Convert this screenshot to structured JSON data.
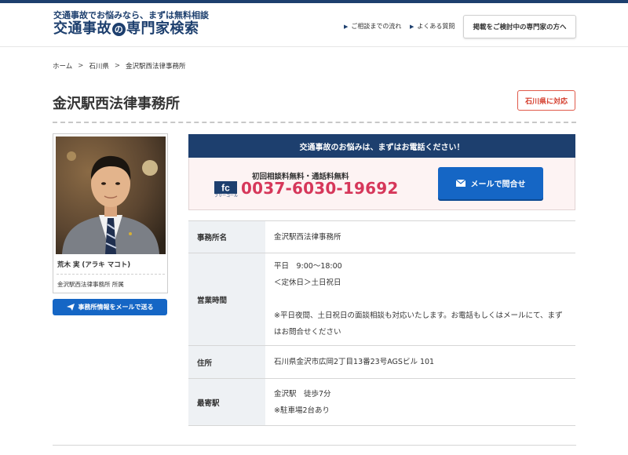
{
  "header": {
    "tagline": "交通事故でお悩みなら、まずは無料相談",
    "title_part1": "交通事故",
    "title_circle": "の",
    "title_part2": "専門家検索",
    "nav": [
      {
        "label": "ご相談までの流れ"
      },
      {
        "label": "よくある質問"
      }
    ],
    "expert_button": "掲載をご検討中の専門家の方へ"
  },
  "breadcrumb": [
    "ホーム",
    "石川県",
    "金沢駅西法律事務所"
  ],
  "page": {
    "title": "金沢駅西法律事務所",
    "prefecture_badge": "石川県に対応"
  },
  "profile": {
    "name": "荒木 実 (アラキ マコト)",
    "affiliation": "金沢駅西法律事務所 所属",
    "mail_office_button": "事務所情報をメールで送る"
  },
  "contact": {
    "heading": "交通事故のお悩みは、まずはお電話ください！",
    "free_note": "初回相談料無料・通話料無料",
    "freecall_logo_text": "フリーコール",
    "phone": "0037-6030-19692",
    "mail_button": "メールで問合せ"
  },
  "info": {
    "office_name_label": "事務所名",
    "office_name": "金沢駅西法律事務所",
    "hours_label": "営業時間",
    "hours_line1": "平日　9:00〜18:00",
    "hours_line2": "＜定休日＞土日祝日",
    "hours_note": "※平日夜間、土日祝日の面談相談も対応いたします。お電話もしくはメールにて、まずはお問合せください",
    "address_label": "住所",
    "address": "石川県金沢市広岡2丁目13番23号AGSビル 101",
    "station_label": "最寄駅",
    "station_line1": "金沢駅　徒歩7分",
    "station_line2": "※駐車場2台あり"
  },
  "colors": {
    "navy": "#1d3f6e",
    "button_blue": "#1566c5",
    "phone_pink": "#d6375a",
    "badge_red": "#d43c2b"
  },
  "icons": {
    "nav_marker": "triangle-right-icon",
    "send": "paper-plane-icon",
    "mail": "envelope-icon",
    "freecall": "freecall-logo-icon"
  }
}
